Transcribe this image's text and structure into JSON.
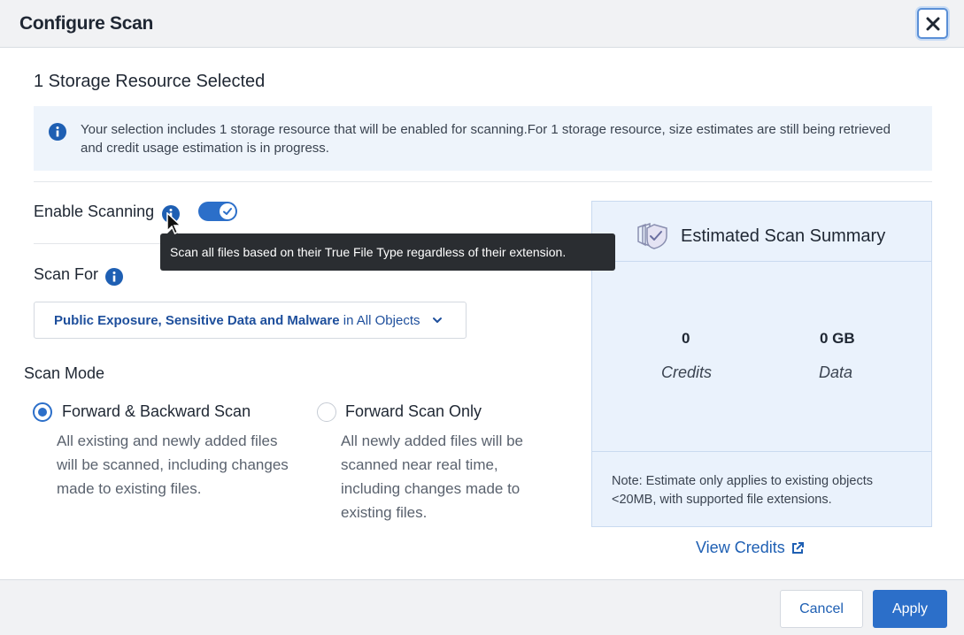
{
  "dialog": {
    "title": "Configure Scan",
    "close_icon": "close-icon"
  },
  "subtitle": "1 Storage Resource Selected",
  "info_banner": {
    "icon": "info-icon",
    "text": "Your selection includes 1 storage resource that will be enabled for scanning.For 1 storage resource, size estimates are still being retrieved and credit usage estimation is in progress."
  },
  "enable_scanning": {
    "label": "Enable Scanning",
    "enabled": true,
    "tooltip": "Scan all files based on their True File Type regardless of their extension."
  },
  "scan_for": {
    "label": "Scan For",
    "selection_bold": "Public Exposure, Sensitive Data and Malware",
    "selection_rest": " in All Objects"
  },
  "scan_mode": {
    "label": "Scan Mode",
    "options": [
      {
        "title": "Forward & Backward Scan",
        "desc_lines": [
          "All existing and newly added files",
          "will be scanned, including changes",
          "made to existing files."
        ],
        "selected": true
      },
      {
        "title": "Forward Scan Only",
        "desc_lines": [
          "All newly added files will be",
          "scanned near real time,",
          "including changes made to",
          "existing files."
        ],
        "selected": false
      }
    ]
  },
  "summary": {
    "title": "Estimated Scan Summary",
    "credits_value": "0",
    "credits_label": "Credits",
    "data_value": "0 GB",
    "data_label": "Data",
    "note": "Note: Estimate only applies to existing objects <20MB, with supported file extensions."
  },
  "view_credits": "View Credits",
  "footer": {
    "cancel": "Cancel",
    "apply": "Apply"
  },
  "colors": {
    "accent": "#2c6fc9",
    "link": "#1e5fb3",
    "summary_bg": "#eaf2fc",
    "banner_bg": "#eef4fb"
  }
}
